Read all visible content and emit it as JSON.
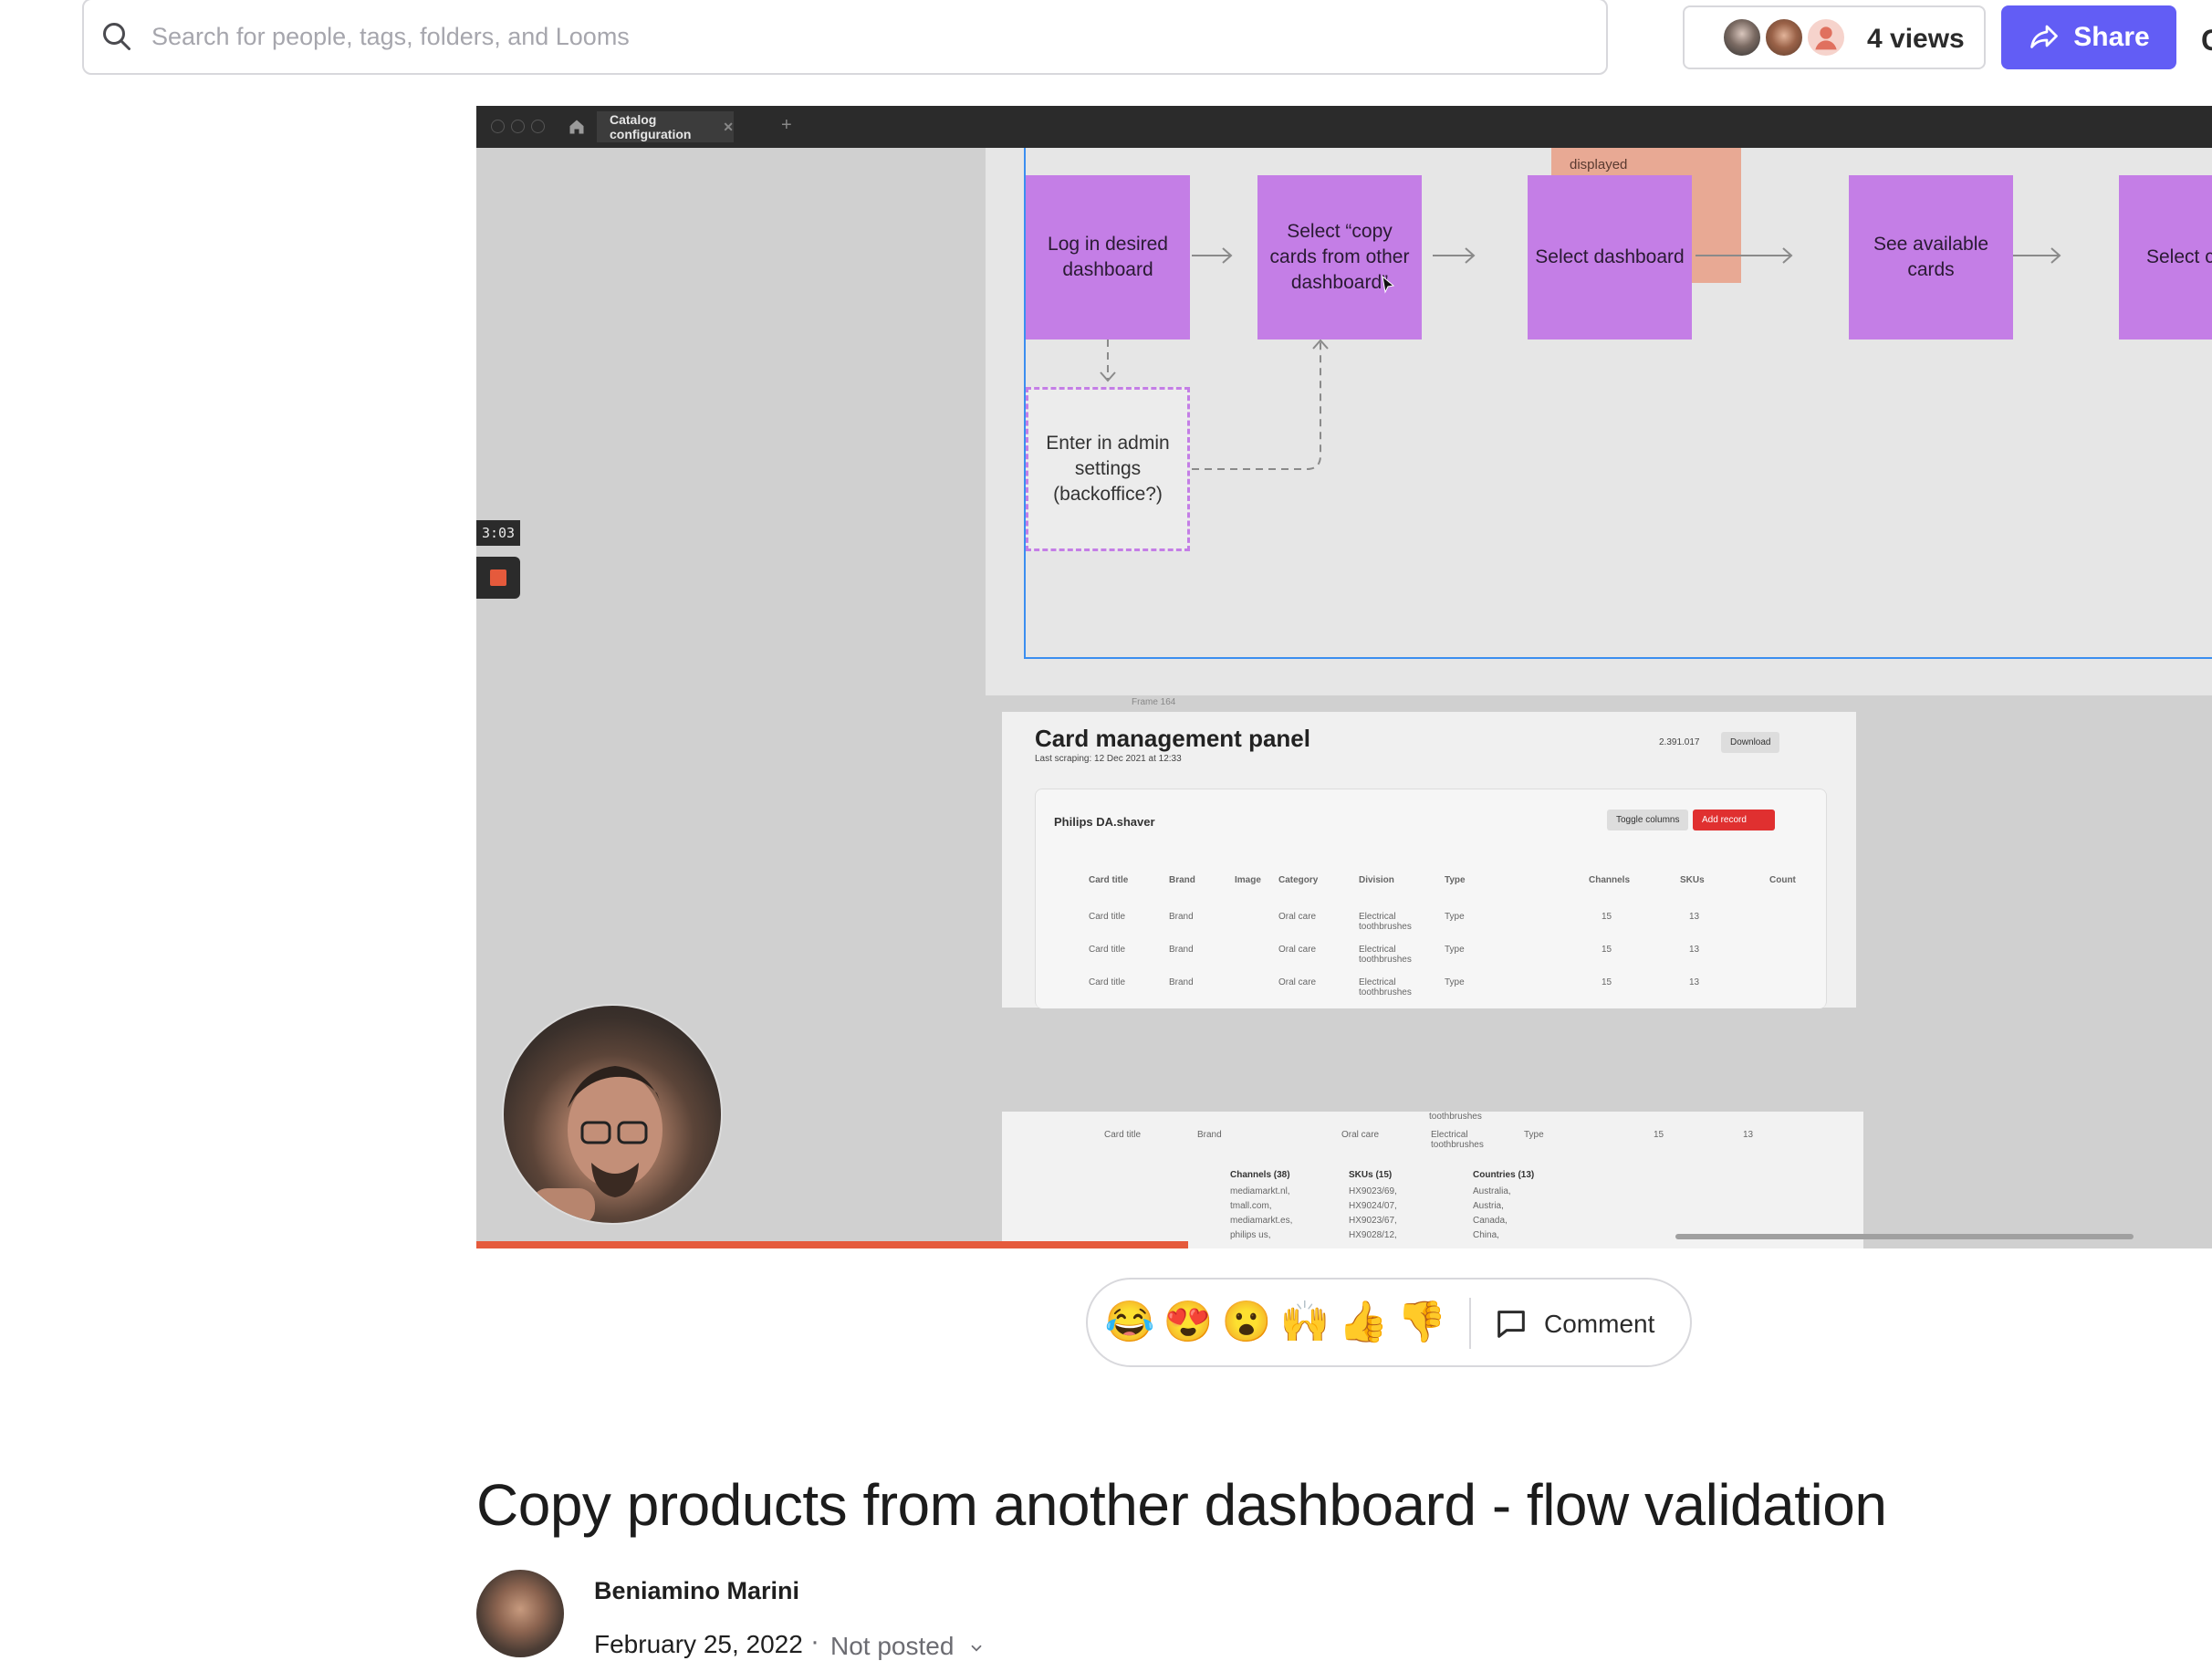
{
  "search": {
    "placeholder": "Search for people, tags, folders, and Looms"
  },
  "header": {
    "views_label": "4 views",
    "share_label": "Share",
    "edge_glyph": "C"
  },
  "video": {
    "tab_title": "Catalog configuration",
    "timer": "3:03",
    "progress_fraction": 0.41,
    "flow": {
      "top_note": "displayed",
      "steps": [
        "Log in desired dashboard",
        "Select “copy cards from other dashboard”",
        "Select dashboard",
        "See available cards",
        "Select c"
      ],
      "alt_step": "Enter in admin settings (backoffice?)"
    },
    "panel": {
      "frame_label": "Frame 164",
      "title": "Card management panel",
      "subtitle": "Last scraping: 12 Dec 2021 at 12:33",
      "link_count": "2.391.017",
      "download_label": "Download",
      "table_title": "Philips DA.shaver",
      "toggle_label": "Toggle columns",
      "add_label": "Add record",
      "columns": [
        "Card title",
        "Brand",
        "Image",
        "Category",
        "Division",
        "Type",
        "Channels",
        "SKUs",
        "Count"
      ],
      "rows": [
        [
          "Card title",
          "Brand",
          "Oral care",
          "Electrical toothbrushes",
          "Type",
          "15",
          "13"
        ],
        [
          "Card title",
          "Brand",
          "Oral care",
          "Electrical toothbrushes",
          "Type",
          "15",
          "13"
        ],
        [
          "Card title",
          "Brand",
          "Oral care",
          "Electrical toothbrushes",
          "Type",
          "15",
          "13"
        ]
      ]
    },
    "panel2": {
      "top_text": "toothbrushes",
      "row": [
        "Card title",
        "Brand",
        "Oral care",
        "Electrical toothbrushes",
        "Type",
        "15",
        "13"
      ],
      "channels_head": "Channels (38)",
      "channels": [
        "mediamarkt.nl,",
        "tmall.com,",
        "mediamarkt.es,",
        "philips us,"
      ],
      "skus_head": "SKUs (15)",
      "skus": [
        "HX9023/69,",
        "HX9024/07,",
        "HX9023/67,",
        "HX9028/12,"
      ],
      "countries_head": "Countries (13)",
      "countries": [
        "Australia,",
        "Austria,",
        "Canada,",
        "China,"
      ]
    }
  },
  "reactions": {
    "emojis": [
      "😂",
      "😍",
      "😮",
      "🙌",
      "👍",
      "👎"
    ],
    "comment_label": "Comment"
  },
  "video_info": {
    "title": "Copy products from another dashboard - flow validation",
    "author": "Beniamino Marini",
    "date": "February 25, 2022",
    "separator": "·",
    "status": "Not posted"
  }
}
